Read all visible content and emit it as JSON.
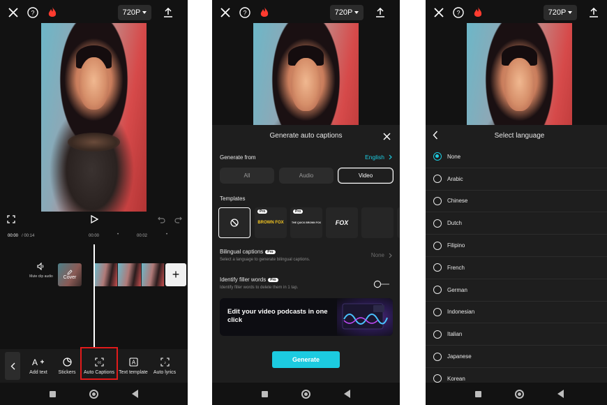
{
  "colors": {
    "accent": "#1ccbe0",
    "highlight": "#e21b1b",
    "background": "#121212",
    "sheet": "#1e1e1e"
  },
  "panel1": {
    "resolution": "720P",
    "time_current": "00:00",
    "time_total": "/ 00:14",
    "ruler_marks": [
      "00:00",
      "00:02"
    ],
    "mute_label": "Mute clip audio",
    "cover_label": "Cover",
    "add_clip": "+",
    "tools": [
      {
        "label": "Add text",
        "icon": "add-text-icon"
      },
      {
        "label": "Stickers",
        "icon": "stickers-icon"
      },
      {
        "label": "Auto Captions",
        "icon": "auto-captions-icon"
      },
      {
        "label": "Text template",
        "icon": "text-template-icon"
      },
      {
        "label": "Auto lyrics",
        "icon": "auto-lyrics-icon"
      }
    ]
  },
  "panel2": {
    "resolution": "720P",
    "title": "Generate auto captions",
    "generate_from_label": "Generate from",
    "language_value": "English",
    "sources": [
      "All",
      "Audio",
      "Video"
    ],
    "selected_source": "Video",
    "templates_label": "Templates",
    "templates": [
      {
        "text": "",
        "pro": false
      },
      {
        "text": "BROWN FOX",
        "pro": true
      },
      {
        "text": "THE QUICK BROWN FOX",
        "pro": true
      },
      {
        "text": "FOX",
        "pro": false
      },
      {
        "text": "",
        "pro": false
      }
    ],
    "pro_badge": "Pro",
    "bilingual_label": "Bilingual captions",
    "bilingual_sub": "Select a language to generate bilingual captions.",
    "bilingual_value": "None",
    "filler_label": "Identify filler words",
    "filler_sub": "Identify filler words to delete them in 1 tap.",
    "filler_enabled": false,
    "promo_text": "Edit your video podcasts in one click",
    "generate_button": "Generate"
  },
  "panel3": {
    "resolution": "720P",
    "title": "Select language",
    "languages": [
      "None",
      "Arabic",
      "Chinese",
      "Dutch",
      "Filipino",
      "French",
      "German",
      "Indonesian",
      "Italian",
      "Japanese",
      "Korean"
    ],
    "selected_language": "None"
  }
}
